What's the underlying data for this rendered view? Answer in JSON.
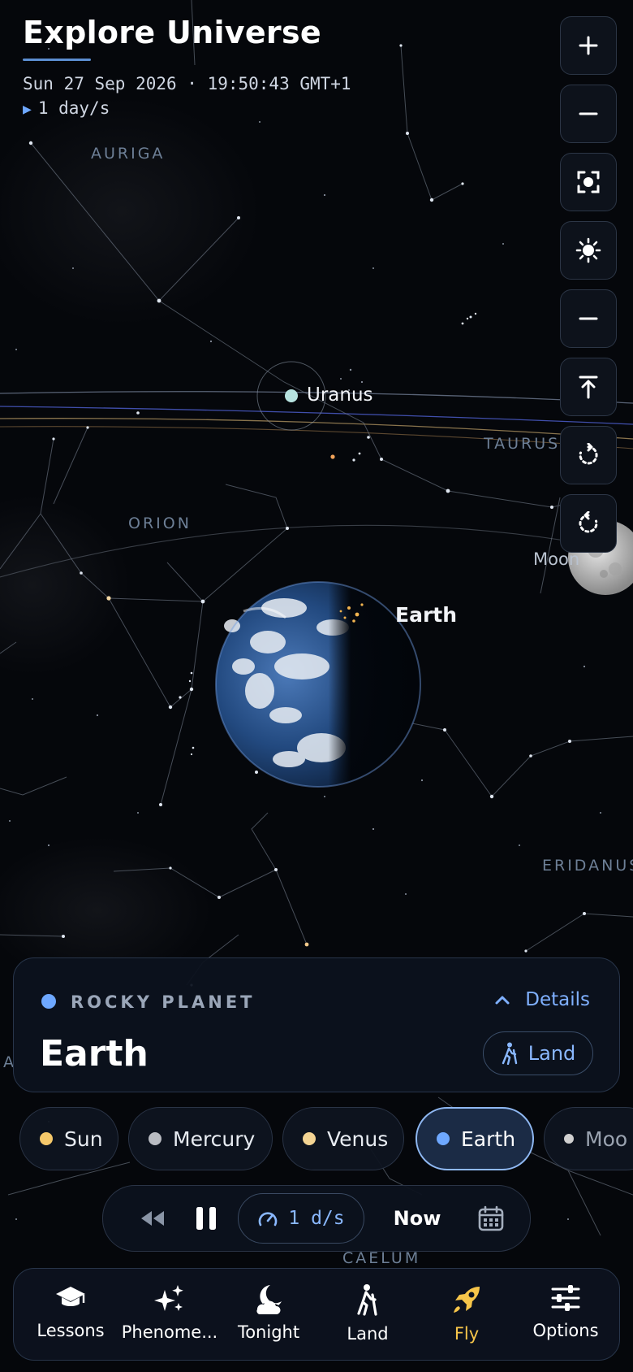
{
  "header": {
    "title": "Explore Universe",
    "datetime": "Sun 27 Sep 2026 · 19:50:43 GMT+1",
    "rate_icon": "play-triangle",
    "rate": "1 day/s"
  },
  "side_controls": [
    {
      "name": "zoom-in-button",
      "icon": "plus-icon"
    },
    {
      "name": "zoom-out-button",
      "icon": "minus-icon"
    },
    {
      "name": "focus-button",
      "icon": "focus-frame-icon"
    },
    {
      "name": "brightness-button",
      "icon": "sun-icon"
    },
    {
      "name": "collapse-button",
      "icon": "minus-icon"
    },
    {
      "name": "top-view-button",
      "icon": "arrow-up-bar-icon"
    },
    {
      "name": "rotate-left-button",
      "icon": "rotate-ccw-icon"
    },
    {
      "name": "rotate-right-button",
      "icon": "rotate-cw-icon"
    }
  ],
  "sky": {
    "constellations": {
      "auriga": "AURIGA",
      "taurus": "TAURUS",
      "orion": "ORION",
      "eridanus": "ERIDANUS",
      "caelum": "CAELUM",
      "partial_left": "A"
    },
    "bodies": {
      "uranus": "Uranus",
      "earth": "Earth",
      "moon": "Moon"
    }
  },
  "info_card": {
    "type": "ROCKY PLANET",
    "type_color": "#6ea8ff",
    "details": "Details",
    "name": "Earth",
    "land_button": "Land"
  },
  "bodies_chips": [
    {
      "label": "Sun",
      "color": "#f5c86a"
    },
    {
      "label": "Mercury",
      "color": "#b9bcc2"
    },
    {
      "label": "Venus",
      "color": "#f3d493"
    },
    {
      "label": "Earth",
      "color": "#6ea8ff",
      "active": true
    },
    {
      "label": "Moo",
      "color": "#d0d0d0"
    }
  ],
  "transport": {
    "speed": "1 d/s",
    "now": "Now"
  },
  "nav": [
    {
      "label": "Lessons",
      "icon": "graduation-cap-icon"
    },
    {
      "label": "Phenome...",
      "icon": "sparkles-icon"
    },
    {
      "label": "Tonight",
      "icon": "moon-cloud-icon"
    },
    {
      "label": "Land",
      "icon": "hiker-icon"
    },
    {
      "label": "Fly",
      "icon": "rocket-icon",
      "active": true
    },
    {
      "label": "Options",
      "icon": "sliders-icon"
    }
  ],
  "colors": {
    "background": "#05070b",
    "accent": "#6ea8ff",
    "active_nav": "#f6c54a"
  }
}
